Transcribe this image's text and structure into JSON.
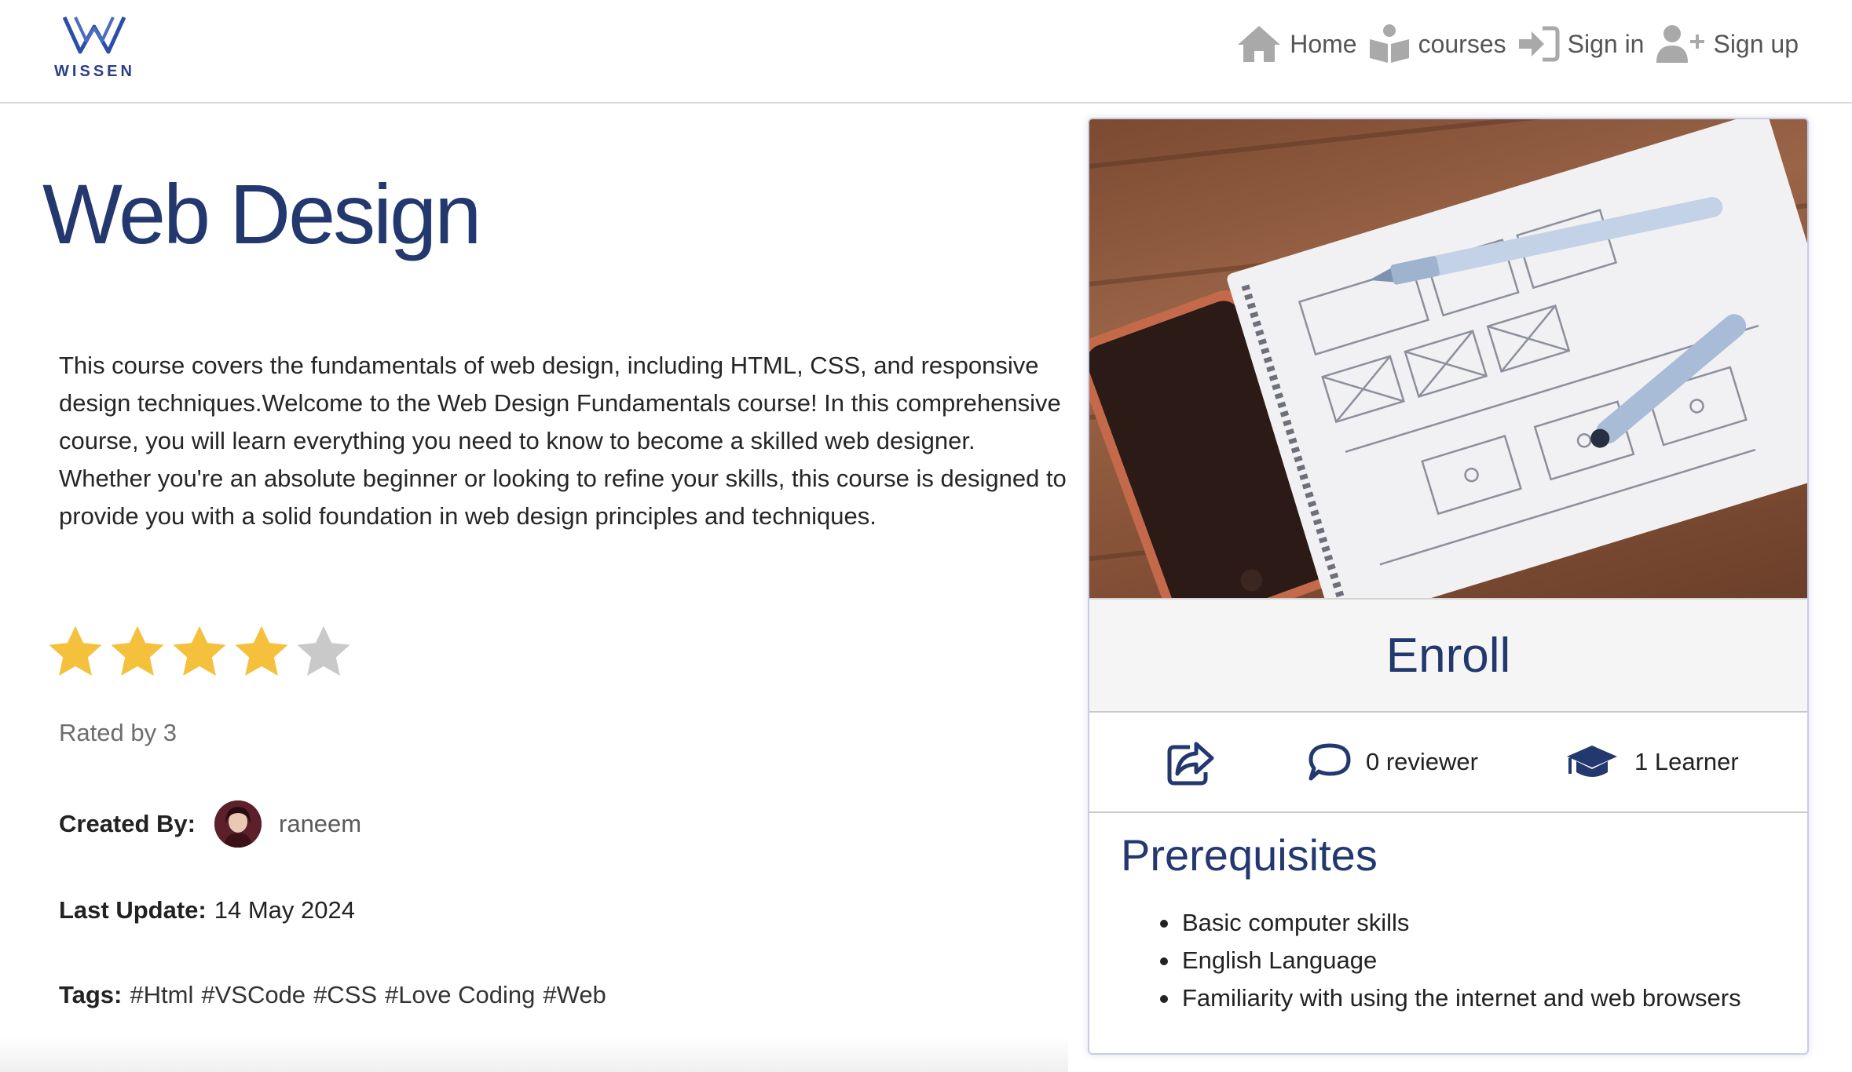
{
  "brand": {
    "name": "WISSEN",
    "color": "#2b3f86"
  },
  "nav": {
    "items": [
      {
        "label": "Home",
        "icon": "home-icon"
      },
      {
        "label": "courses",
        "icon": "books-icon"
      },
      {
        "label": "Sign in",
        "icon": "sign-in-icon"
      },
      {
        "label": "Sign up",
        "icon": "user-plus-icon"
      }
    ]
  },
  "course": {
    "title": "Web Design",
    "description": "This course covers the fundamentals of web design, including HTML, CSS, and responsive design techniques.Welcome to the Web Design Fundamentals course! In this comprehensive course, you will learn everything you need to know to become a skilled web designer. Whether you're an absolute beginner or looking to refine your skills, this course is designed to provide you with a solid foundation in web design principles and techniques.",
    "rating": {
      "value": 4,
      "max": 5,
      "rated_by": "Rated by 3"
    },
    "created_by_label": "Created By:",
    "author": "raneem",
    "last_update_label": "Last Update:",
    "last_update": "14 May 2024",
    "tags_label": "Tags:",
    "tags": [
      "#Html",
      "#VSCode",
      "#CSS",
      "#Love Coding",
      "#Web"
    ]
  },
  "card": {
    "enroll_label": "Enroll",
    "reviewers": "0 reviewer",
    "learners": "1 Learner",
    "prerequisites_title": "Prerequisites",
    "prerequisites": [
      "Basic computer skills",
      "English Language",
      "Familiarity with using the internet and web browsers"
    ]
  },
  "colors": {
    "title": "#22386e",
    "star_filled": "#f5c13d",
    "star_empty": "#c9c9c9",
    "accent": "#22386e"
  }
}
